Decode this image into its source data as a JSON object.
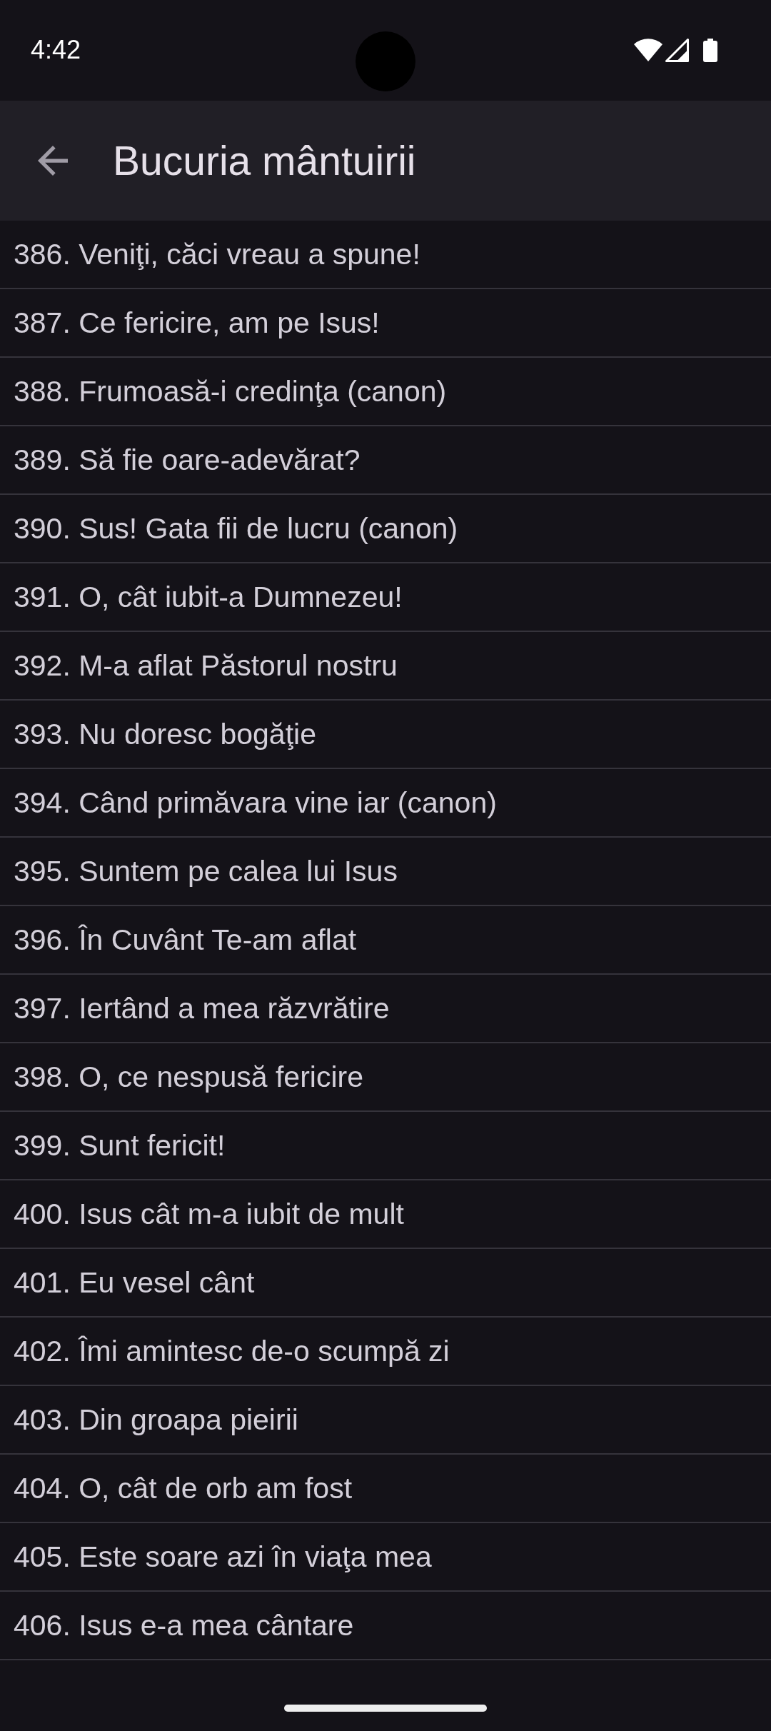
{
  "status_bar": {
    "time": "4:42"
  },
  "app_bar": {
    "title": "Bucuria mântuirii"
  },
  "songs": [
    "386. Veniţi, căci vreau a spune!",
    "387. Ce fericire, am pe Isus!",
    "388. Frumoasă-i credinţa (canon)",
    "389. Să fie oare-adevărat?",
    "390. Sus! Gata fii de lucru (canon)",
    "391. O, cât iubit-a Dumnezeu!",
    "392. M-a aflat Păstorul nostru",
    "393. Nu doresc bogăţie",
    "394. Când primăvara vine iar (canon)",
    "395. Suntem pe calea lui Isus",
    "396. În Cuvânt Te-am aflat",
    "397. Iertând a mea răzvrătire",
    "398. O, ce nespusă fericire",
    "399. Sunt fericit!",
    "400. Isus cât m-a iubit de mult",
    "401. Eu vesel cânt",
    "402. Îmi amintesc de-o scumpă zi",
    "403. Din groapa pieirii",
    "404. O, cât de orb am fost",
    "405. Este soare azi în viaţa mea",
    "406. Isus e-a mea cântare"
  ]
}
